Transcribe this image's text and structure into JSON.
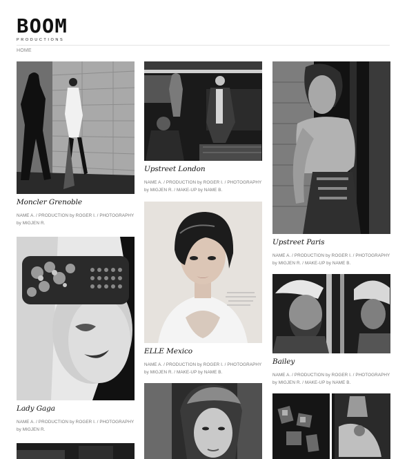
{
  "brand": {
    "name": "BOOM",
    "subtitle": "PRODUCTIONS"
  },
  "breadcrumb": {
    "home": "HOME"
  },
  "portfolio": [
    {
      "title": "Moncler Grenoble",
      "credits": "NAME A. / PRODUCTION by ROGER I. / PHOTOGRAPHY by MIGJEN R."
    },
    {
      "title": "Lady Gaga",
      "credits": "NAME A. / PRODUCTION by ROGER I. / PHOTOGRAPHY by MIGJEN R."
    },
    {
      "title": "Upstreet London",
      "credits": "NAME A. / PRODUCTION by ROGER I. / PHOTOGRAPHY by MIGJEN R. / MAKE-UP by NAME B."
    },
    {
      "title": "ELLE Mexico",
      "credits": "NAME A. / PRODUCTION by ROGER I. / PHOTOGRAPHY by MIGJEN R. / MAKE-UP by NAME B."
    },
    {
      "title": "Upstreet Paris",
      "credits": "NAME A. / PRODUCTION by ROGER I. / PHOTOGRAPHY by MIGJEN R. / MAKE-UP by NAME B."
    },
    {
      "title": "Bailey",
      "credits": "NAME A. / PRODUCTION by ROGER I. / PHOTOGRAPHY by MIGJEN R. / MAKE-UP by NAME B."
    }
  ]
}
